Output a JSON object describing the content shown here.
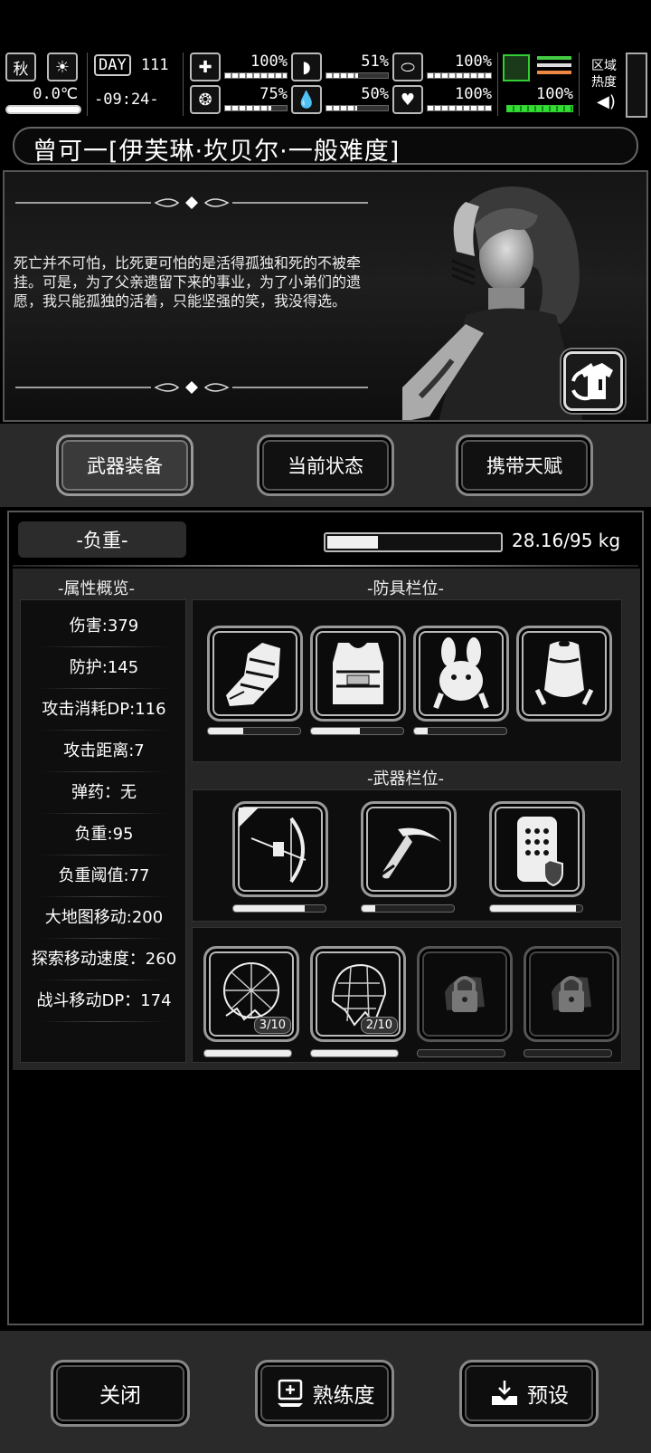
{
  "status": {
    "season": "秋",
    "temperature": "0.0℃",
    "day_label": "DAY",
    "day_value": "111",
    "time": "-09:24-",
    "health": "100%",
    "hunger": "51%",
    "stamina": "100%",
    "sanity": "75%",
    "thirst": "50%",
    "mood": "100%",
    "battery": "100%",
    "zone_heat_label": "区域热度",
    "bars": {
      "health": 1.0,
      "hunger": 0.51,
      "stamina": 1.0,
      "sanity": 0.75,
      "thirst": 0.5,
      "mood": 1.0,
      "battery": 1.0
    }
  },
  "character": {
    "title": "曾可一[伊芙琳·坎贝尔·一般难度]",
    "quote": "死亡并不可怕，比死更可怕的是活得孤独和死的不被牵挂。可是，为了父亲遗留下来的事业，为了小弟们的遗愿，我只能孤独的活着，只能坚强的笑，我没得选。"
  },
  "tabs": [
    "武器装备",
    "当前状态",
    "携带天赋"
  ],
  "weight": {
    "label": "-负重-",
    "text": "28.16/95 kg",
    "fraction": 0.296
  },
  "attributes": {
    "header": "-属性概览-",
    "rows": [
      "伤害:379",
      "防护:145",
      "攻击消耗DP:116",
      "攻击距离:7",
      "弹药：无",
      "负重:95",
      "负重阈值:77",
      "大地图移动:200",
      "探索移动速度：260",
      "战斗移动DP：174"
    ]
  },
  "armor": {
    "header": "-防具栏位-",
    "durability": [
      0.38,
      0.53,
      0.15,
      0.0
    ]
  },
  "weapons": {
    "header": "-武器栏位-",
    "durability": [
      0.77,
      0.15,
      0.93
    ]
  },
  "consumables": {
    "counts": [
      "3/10",
      "2/10"
    ],
    "durability": [
      1.0,
      1.0,
      0.0,
      0.0
    ]
  },
  "bottom": {
    "close": "关闭",
    "proficiency": "熟练度",
    "preset": "预设"
  }
}
